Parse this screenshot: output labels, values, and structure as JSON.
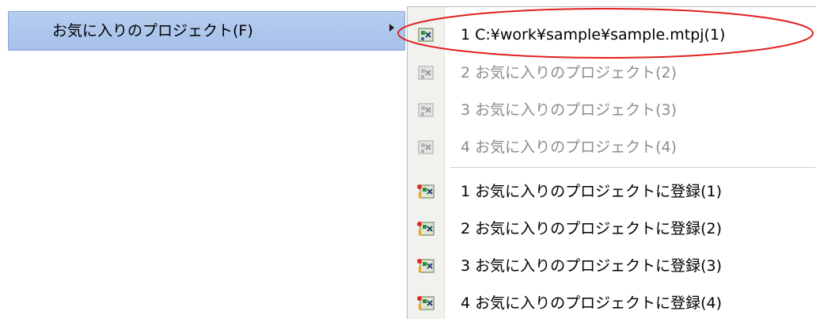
{
  "parent_menu": {
    "label": "お気に入りのプロジェクト(F)",
    "highlight_color": "#a6c0ea"
  },
  "submenu": {
    "recent_items": [
      {
        "label": "1 C:¥work¥sample¥sample.mtpj(1)",
        "enabled": true,
        "icon": "project-icon"
      },
      {
        "label": "2 お気に入りのプロジェクト(2)",
        "enabled": false,
        "icon": "project-icon"
      },
      {
        "label": "3 お気に入りのプロジェクト(3)",
        "enabled": false,
        "icon": "project-icon"
      },
      {
        "label": "4 お気に入りのプロジェクト(4)",
        "enabled": false,
        "icon": "project-icon"
      }
    ],
    "register_items": [
      {
        "label": "1 お気に入りのプロジェクトに登録(1)",
        "enabled": true,
        "icon": "register-project-icon"
      },
      {
        "label": "2 お気に入りのプロジェクトに登録(2)",
        "enabled": true,
        "icon": "register-project-icon"
      },
      {
        "label": "3 お気に入りのプロジェクトに登録(3)",
        "enabled": true,
        "icon": "register-project-icon"
      },
      {
        "label": "4 お気に入りのプロジェクトに登録(4)",
        "enabled": true,
        "icon": "register-project-icon"
      }
    ]
  },
  "annotation": {
    "color": "#e02020"
  }
}
